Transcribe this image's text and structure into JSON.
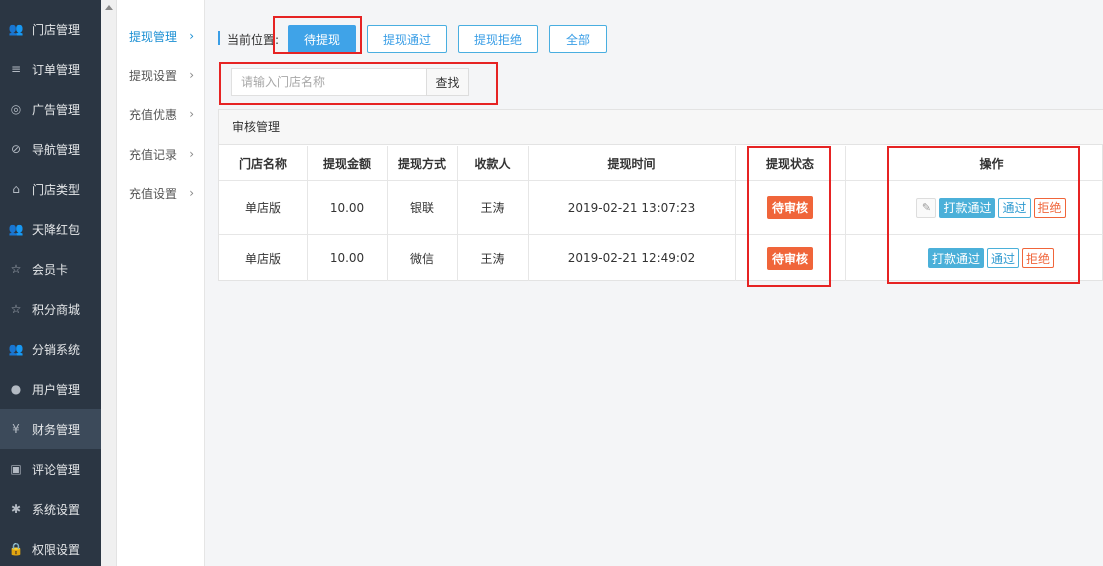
{
  "sidebar": {
    "items": [
      {
        "icon": "users-icon",
        "glyph": "👥",
        "label": "门店管理"
      },
      {
        "icon": "list-icon",
        "glyph": "≡",
        "label": "订单管理"
      },
      {
        "icon": "lifebuoy-icon",
        "glyph": "◎",
        "label": "广告管理"
      },
      {
        "icon": "compass-icon",
        "glyph": "⊘",
        "label": "导航管理"
      },
      {
        "icon": "bank-icon",
        "glyph": "⌂",
        "label": "门店类型"
      },
      {
        "icon": "users-icon",
        "glyph": "👥",
        "label": "天降红包"
      },
      {
        "icon": "star-icon",
        "glyph": "☆",
        "label": "会员卡"
      },
      {
        "icon": "star-icon",
        "glyph": "☆",
        "label": "积分商城"
      },
      {
        "icon": "group-icon",
        "glyph": "👥",
        "label": "分销系统"
      },
      {
        "icon": "user-icon",
        "glyph": "●",
        "label": "用户管理"
      },
      {
        "icon": "yen-icon",
        "glyph": "¥",
        "label": "财务管理"
      },
      {
        "icon": "money-icon",
        "glyph": "▣",
        "label": "评论管理"
      },
      {
        "icon": "gear-icon",
        "glyph": "✱",
        "label": "系统设置"
      },
      {
        "icon": "lock-icon",
        "glyph": "🔒",
        "label": "权限设置"
      }
    ]
  },
  "submenu": {
    "items": [
      {
        "label": "提现管理"
      },
      {
        "label": "提现设置"
      },
      {
        "label": "充值优惠"
      },
      {
        "label": "充值记录"
      },
      {
        "label": "充值设置"
      }
    ]
  },
  "breadcrumb": {
    "label": "当前位置:"
  },
  "tabs": [
    {
      "label": "待提现"
    },
    {
      "label": "提现通过"
    },
    {
      "label": "提现拒绝"
    },
    {
      "label": "全部"
    }
  ],
  "search": {
    "placeholder": "请输入门店名称",
    "button": "查找"
  },
  "panel": {
    "title": "审核管理"
  },
  "table": {
    "headers": [
      "门店名称",
      "提现金额",
      "提现方式",
      "收款人",
      "提现时间",
      "提现状态",
      "操作"
    ],
    "rows": [
      {
        "store": "单店版",
        "amount": "10.00",
        "method": "银联",
        "payee": "王涛",
        "time": "2019-02-21 13:07:23",
        "status": "待审核"
      },
      {
        "store": "单店版",
        "amount": "10.00",
        "method": "微信",
        "payee": "王涛",
        "time": "2019-02-21 12:49:02",
        "status": "待审核"
      }
    ],
    "actions": {
      "pay": "打款通过",
      "pass": "通过",
      "reject": "拒绝"
    }
  },
  "colors": {
    "sidebar": "#2b3643",
    "accent": "#3fa3e8",
    "status": "#f0653a",
    "highlight": "#e62323"
  }
}
